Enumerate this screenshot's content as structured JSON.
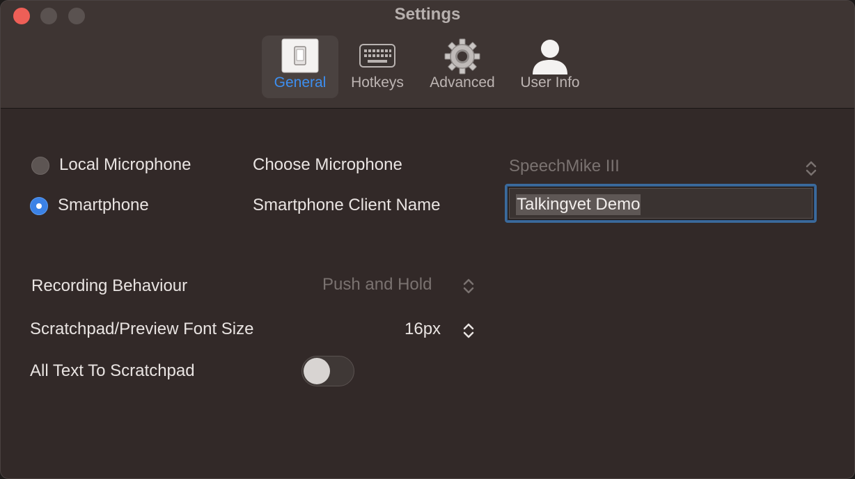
{
  "window": {
    "title": "Settings"
  },
  "tabs": [
    {
      "label": "General",
      "icon": "switch-icon",
      "active": true
    },
    {
      "label": "Hotkeys",
      "icon": "keyboard-icon",
      "active": false
    },
    {
      "label": "Advanced",
      "icon": "gear-icon",
      "active": false
    },
    {
      "label": "User Info",
      "icon": "user-icon",
      "active": false
    }
  ],
  "input_source": {
    "local_label": "Local Microphone",
    "smartphone_label": "Smartphone",
    "selected": "Smartphone"
  },
  "microphone": {
    "label": "Choose Microphone",
    "value": "SpeechMike III"
  },
  "smartphone_client": {
    "label": "Smartphone Client Name",
    "value": "Talkingvet Demo"
  },
  "recording_behaviour": {
    "label": "Recording Behaviour",
    "value": "Push and Hold"
  },
  "font_size": {
    "label": "Scratchpad/Preview Font Size",
    "value": "16px"
  },
  "all_text_to_scratchpad": {
    "label": "All Text To Scratchpad",
    "enabled": false
  },
  "colors": {
    "accent": "#3b82e6",
    "window_bg": "#322928",
    "focus_ring": "#3b6a9c"
  }
}
